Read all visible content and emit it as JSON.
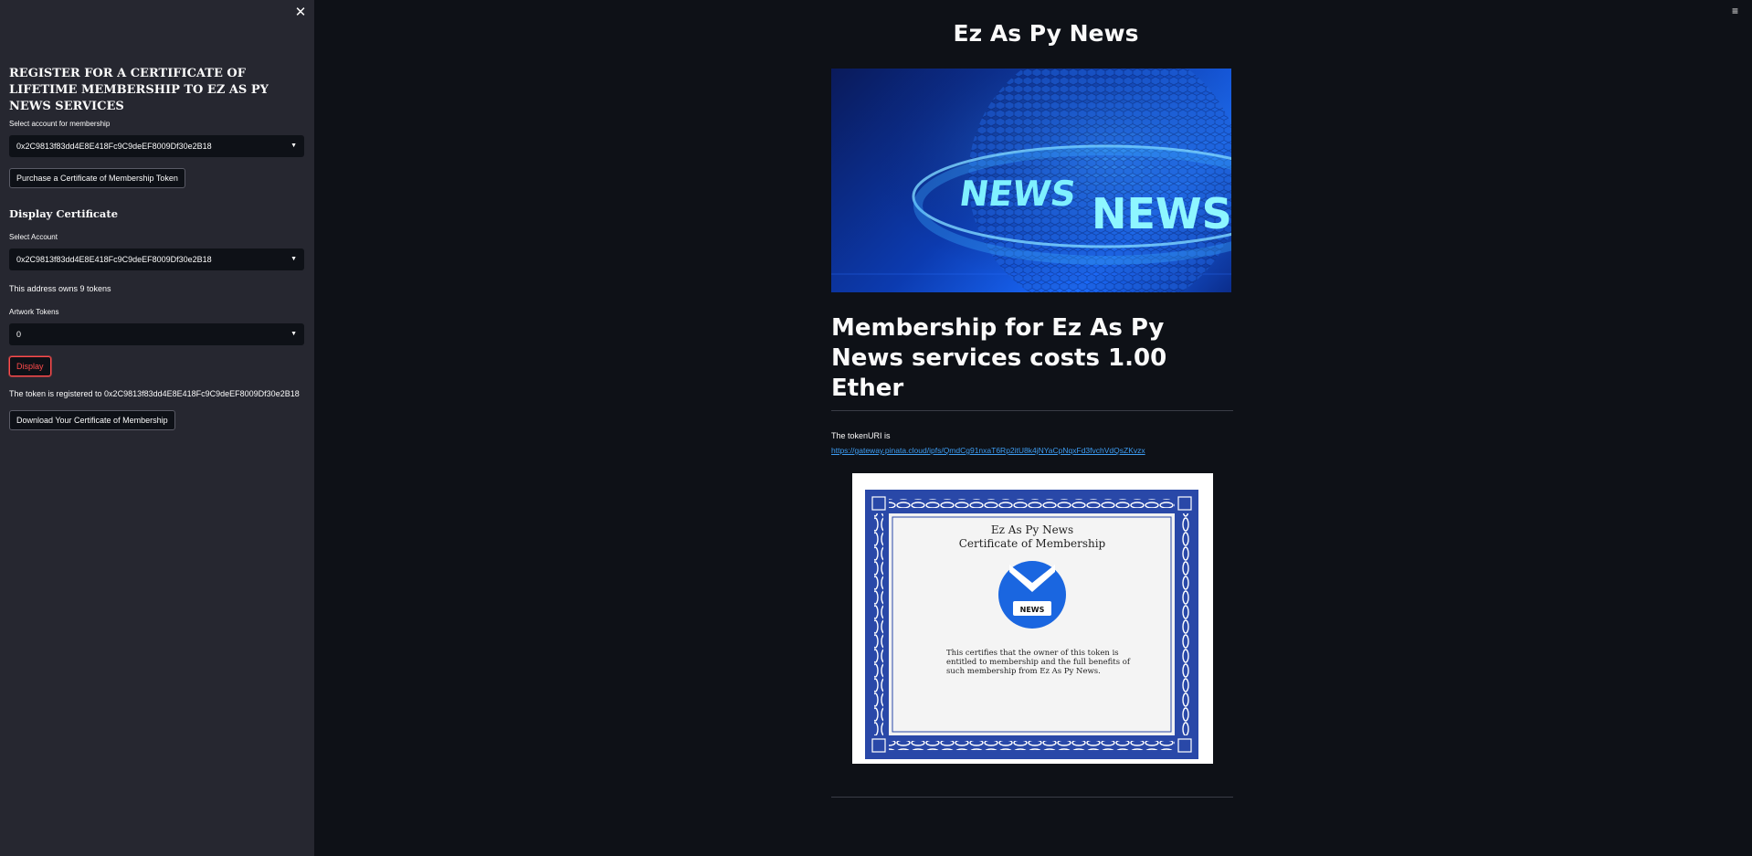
{
  "sidebar": {
    "heading": "REGISTER FOR A CERTIFICATE OF LIFETIME MEMBERSHIP TO EZ AS PY NEWS SERVICES",
    "membership_label": "Select account for membership",
    "membership_account": "0x2C9813f83dd4E8E418Fc9C9deEF8009Df30e2B18",
    "purchase_button": "Purchase a Certificate of Membership Token",
    "display_heading": "Display Certificate",
    "select_account_label": "Select Account",
    "display_account": "0x2C9813f83dd4E8E418Fc9C9deEF8009Df30e2B18",
    "owns_text": "This address owns 9 tokens",
    "artwork_label": "Artwork Tokens",
    "artwork_value": "0",
    "display_button": "Display",
    "registered_text": "The token is registered to 0x2C9813f83dd4E8E418Fc9C9deEF8009Df30e2B18",
    "download_button": "Download Your Certificate of Membership"
  },
  "main": {
    "title": "Ez As Py News",
    "headline": "Membership for Ez As Py News services costs 1.00 Ether",
    "uri_label": "The tokenURI is",
    "uri_link": "https://gateway.pinata.cloud/ipfs/QmdCg91nxaT6Rp2itU8k4jNYaCpNqxFd3fvchVdQsZKvzx"
  },
  "banner": {
    "word1": "NEWS",
    "word2": "NEWS"
  },
  "certificate": {
    "line1": "Ez As Py News",
    "line2": "Certificate of Membership",
    "badge": "NEWS",
    "body1": "This certifies that the owner of this token is",
    "body2": "entitled to membership and the full benefits of",
    "body3": "such membership from Ez As Py News."
  },
  "colors": {
    "background": "#0e1117",
    "sidebar": "#262730",
    "accent": "#ff4b4b",
    "link": "#3d9df3",
    "cert_blue": "#2948a8"
  },
  "icons": {
    "close": "close-icon",
    "menu": "hamburger-menu-icon",
    "caret": "caret-down-icon"
  }
}
